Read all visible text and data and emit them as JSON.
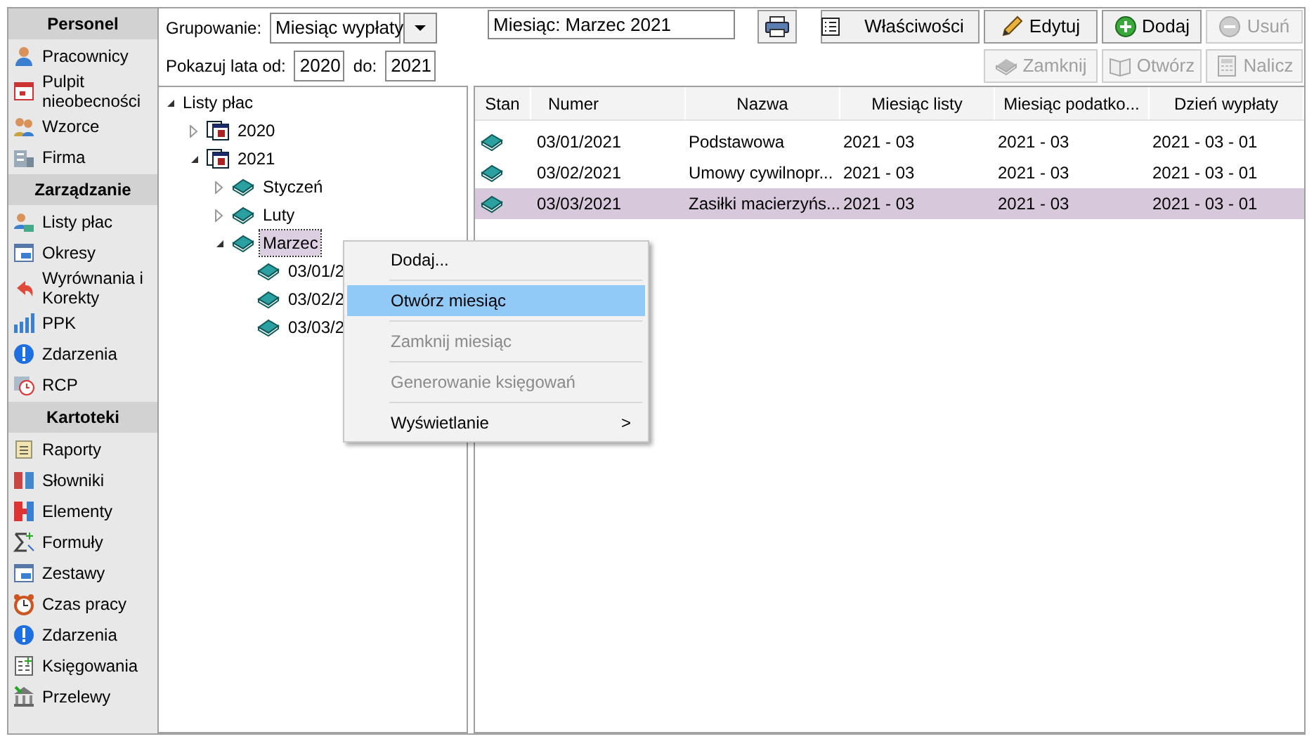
{
  "sidebar": [
    {
      "title": "Personel",
      "items": [
        {
          "label": "Pracownicy"
        },
        {
          "label": "Pulpit nieobecności"
        },
        {
          "label": "Wzorce"
        },
        {
          "label": "Firma"
        }
      ]
    },
    {
      "title": "Zarządzanie",
      "items": [
        {
          "label": "Listy płac"
        },
        {
          "label": "Okresy"
        },
        {
          "label": "Wyrównania i Korekty"
        },
        {
          "label": "PPK"
        },
        {
          "label": "Zdarzenia"
        },
        {
          "label": "RCP"
        }
      ]
    },
    {
      "title": "Kartoteki",
      "items": [
        {
          "label": "Raporty"
        },
        {
          "label": "Słowniki"
        },
        {
          "label": "Elementy"
        },
        {
          "label": "Formuły"
        },
        {
          "label": "Zestawy"
        },
        {
          "label": "Czas pracy"
        },
        {
          "label": "Zdarzenia"
        },
        {
          "label": "Księgowania"
        },
        {
          "label": "Przelewy"
        }
      ]
    }
  ],
  "grouping": {
    "label": "Grupowanie:",
    "value": "Miesiąc wypłaty"
  },
  "years": {
    "label": "Pokazuj lata od:",
    "from": "2020",
    "to_label": "do:",
    "to": "2021"
  },
  "tree": {
    "label": "Listy płac",
    "expanded": true,
    "children": [
      {
        "label": "2020",
        "kind": "year",
        "expanded": false,
        "selected": false
      },
      {
        "label": "2021",
        "kind": "year",
        "expanded": true,
        "selected": false,
        "children": [
          {
            "label": "Styczeń",
            "kind": "book",
            "expanded": false,
            "selected": false
          },
          {
            "label": "Luty",
            "kind": "book",
            "expanded": false,
            "selected": false
          },
          {
            "label": "Marzec",
            "kind": "book",
            "expanded": true,
            "selected": true,
            "children": [
              {
                "label": "03/01/2",
                "kind": "book",
                "selected": false
              },
              {
                "label": "03/02/2",
                "kind": "book",
                "selected": false
              },
              {
                "label": "03/03/2",
                "kind": "book",
                "selected": false
              }
            ]
          }
        ]
      }
    ]
  },
  "month_field": {
    "value": "Miesiąc: Marzec 2021"
  },
  "toolbar": [
    {
      "label": "Właściwości",
      "disabled": false
    },
    {
      "label": "Edytuj",
      "disabled": false
    },
    {
      "label": "Dodaj",
      "disabled": false
    },
    {
      "label": "Usuń",
      "disabled": true
    },
    {
      "label": "Zamknij",
      "disabled": true
    },
    {
      "label": "Otwórz",
      "disabled": true
    },
    {
      "label": "Nalicz",
      "disabled": true
    }
  ],
  "table": {
    "columns": [
      "Stan",
      "Numer",
      "Nazwa",
      "Miesiąc listy",
      "Miesiąc podatko...",
      "Dzień wypłaty"
    ],
    "rows": [
      {
        "selected": false,
        "cells": [
          "",
          "03/01/2021",
          "Podstawowa",
          "2021 - 03",
          "2021 - 03",
          "2021 - 03 - 01"
        ]
      },
      {
        "selected": false,
        "cells": [
          "",
          "03/02/2021",
          "Umowy cywilnopr...",
          "2021 - 03",
          "2021 - 03",
          "2021 - 03 - 01"
        ]
      },
      {
        "selected": true,
        "cells": [
          "",
          "03/03/2021",
          "Zasiłki macierzyńs...",
          "2021 - 03",
          "2021 - 03",
          "2021 - 03 - 01"
        ]
      }
    ]
  },
  "context_menu": [
    {
      "label": "Dodaj...",
      "disabled": false,
      "selected": false
    },
    {
      "label": "Otwórz miesiąc",
      "disabled": false,
      "selected": true
    },
    {
      "label": "Zamknij miesiąc",
      "disabled": true,
      "selected": false
    },
    {
      "label": "Generowanie księgowań",
      "disabled": true,
      "selected": false
    },
    {
      "label": "Wyświetlanie",
      "disabled": false,
      "selected": false,
      "arrow": ">"
    }
  ]
}
